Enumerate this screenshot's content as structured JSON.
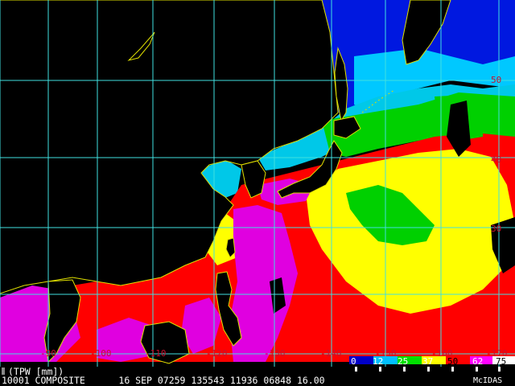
{
  "footer": {
    "product": "(TPW [mm])",
    "info": "10001 COMPOSITE      16 SEP 07259 135543 11936 06848 16.00",
    "source": "McIDAS"
  },
  "legend": {
    "values": [
      "0",
      "12",
      "25",
      "37",
      "50",
      "62",
      "75"
    ],
    "colors": [
      "#0000c8",
      "#00c0ff",
      "#00e000",
      "#ffff00",
      "#ff0000",
      "#ff00ff",
      "#ffffff"
    ]
  },
  "grid": {
    "longitude_labels": [
      "-90",
      "-100",
      "-110",
      "-120",
      "-130",
      "-140",
      "-150",
      "-160",
      "-170"
    ],
    "latitude_labels": [
      "50",
      "40",
      "30"
    ]
  },
  "colors": {
    "gridline": "#40e0e0",
    "coastline": "#e0e000",
    "label": "#c8102e"
  }
}
